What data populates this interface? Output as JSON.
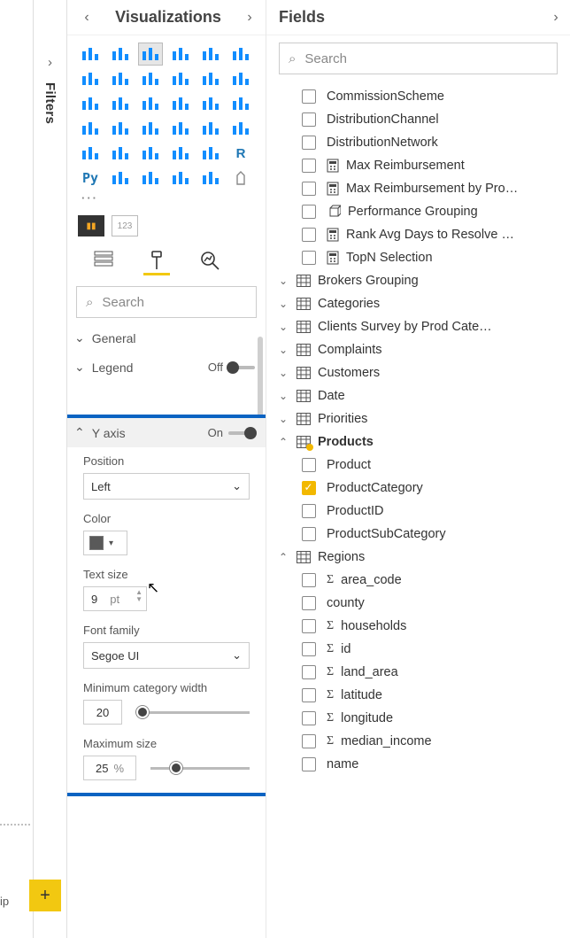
{
  "filters": {
    "label": "Filters"
  },
  "viz_pane": {
    "title": "Visualizations",
    "more": "···",
    "thumb2": "123",
    "search_placeholder": "Search",
    "groups": {
      "general": {
        "label": "General"
      },
      "legend": {
        "label": "Legend",
        "toggle_label": "Off"
      }
    },
    "yaxis": {
      "label": "Y axis",
      "toggle_label": "On",
      "position_label": "Position",
      "position_value": "Left",
      "color_label": "Color",
      "text_size_label": "Text size",
      "text_size_value": "9",
      "text_size_unit": "pt",
      "font_family_label": "Font family",
      "font_family_value": "Segoe UI",
      "min_cat_label": "Minimum category width",
      "min_cat_value": "20",
      "max_size_label": "Maximum size",
      "max_size_value": "25",
      "max_size_unit": "%"
    },
    "gallery_names": [
      "stacked-bar",
      "stacked-column",
      "clustered-bar",
      "clustered-column",
      "100-stacked-bar",
      "100-stacked-column",
      "line",
      "area",
      "stacked-area",
      "line-stacked-column",
      "line-clustered-column",
      "ribbon",
      "waterfall",
      "funnel",
      "scatter",
      "pie",
      "donut",
      "treemap",
      "map",
      "filled-map",
      "shape-map",
      "azure-map",
      "gauge",
      "card",
      "multi-row-card",
      "kpi",
      "slicer",
      "table",
      "matrix",
      "r",
      "py",
      "key-influencers",
      "decomposition-tree",
      "qna",
      "paginated",
      "blank"
    ]
  },
  "fields_pane": {
    "title": "Fields",
    "search_placeholder": "Search",
    "loose_measures": [
      {
        "name": "CommissionScheme",
        "icon": "",
        "checked": false
      },
      {
        "name": "DistributionChannel",
        "icon": "",
        "checked": false
      },
      {
        "name": "DistributionNetwork",
        "icon": "",
        "checked": false
      },
      {
        "name": "Max Reimbursement",
        "icon": "measure",
        "checked": false
      },
      {
        "name": "Max Reimbursement by ProdC…",
        "icon": "measure",
        "checked": false
      },
      {
        "name": "Performance Grouping",
        "icon": "cube",
        "checked": false
      },
      {
        "name": "Rank Avg Days to Resolve Co…",
        "icon": "measure",
        "checked": false
      },
      {
        "name": "TopN Selection",
        "icon": "measure",
        "checked": false
      }
    ],
    "tables": [
      {
        "name": "Brokers Grouping",
        "expanded": false,
        "active": false
      },
      {
        "name": "Categories",
        "expanded": false,
        "active": false
      },
      {
        "name": "Clients Survey by Prod Category",
        "expanded": false,
        "active": false
      },
      {
        "name": "Complaints",
        "expanded": false,
        "active": false
      },
      {
        "name": "Customers",
        "expanded": false,
        "active": false
      },
      {
        "name": "Date",
        "expanded": false,
        "active": false
      },
      {
        "name": "Priorities",
        "expanded": false,
        "active": false
      },
      {
        "name": "Products",
        "expanded": true,
        "active": true,
        "fields": [
          {
            "name": "Product",
            "checked": false
          },
          {
            "name": "ProductCategory",
            "checked": true
          },
          {
            "name": "ProductID",
            "checked": false
          },
          {
            "name": "ProductSubCategory",
            "checked": false
          }
        ]
      },
      {
        "name": "Regions",
        "expanded": true,
        "active": false,
        "fields": [
          {
            "name": "area_code",
            "sigma": true,
            "checked": false
          },
          {
            "name": "county",
            "sigma": false,
            "checked": false
          },
          {
            "name": "households",
            "sigma": true,
            "checked": false
          },
          {
            "name": "id",
            "sigma": true,
            "checked": false
          },
          {
            "name": "land_area",
            "sigma": true,
            "checked": false
          },
          {
            "name": "latitude",
            "sigma": true,
            "checked": false
          },
          {
            "name": "longitude",
            "sigma": true,
            "checked": false
          },
          {
            "name": "median_income",
            "sigma": true,
            "checked": false
          },
          {
            "name": "name",
            "sigma": false,
            "checked": false
          }
        ]
      }
    ]
  },
  "footer": {
    "tip_fragment": "ip",
    "add_page": "+"
  },
  "colors": {
    "highlight_border": "#0a63c2",
    "accent_yellow": "#f2c811"
  }
}
